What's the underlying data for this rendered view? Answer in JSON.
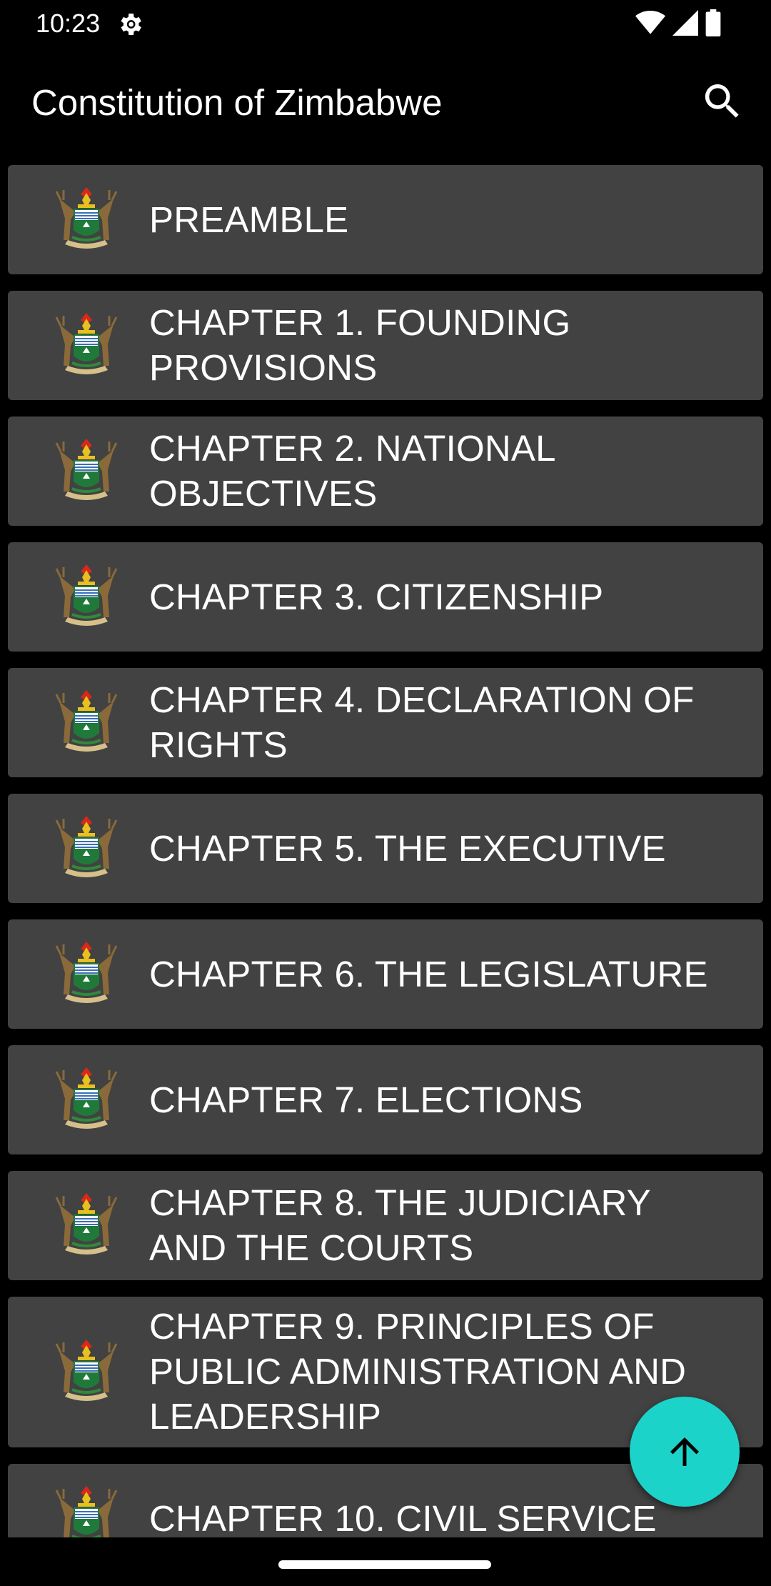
{
  "status_bar": {
    "time": "10:23",
    "icons": [
      "settings-gear-icon",
      "wifi-icon",
      "signal-icon",
      "battery-icon"
    ]
  },
  "app_bar": {
    "title": "Constitution of Zimbabwe",
    "search_icon": "search-icon"
  },
  "colors": {
    "background": "#000000",
    "card": "#424242",
    "fab": "#1bd3c9",
    "text": "#ffffff"
  },
  "chapters": [
    {
      "label": "PREAMBLE",
      "icon": "coat-of-arms-icon"
    },
    {
      "label": "CHAPTER 1. FOUNDING PROVISIONS",
      "icon": "coat-of-arms-icon"
    },
    {
      "label": "CHAPTER 2. NATIONAL OBJECTIVES",
      "icon": "coat-of-arms-icon"
    },
    {
      "label": "CHAPTER 3. CITIZENSHIP",
      "icon": "coat-of-arms-icon"
    },
    {
      "label": "CHAPTER 4. DECLARATION OF RIGHTS",
      "icon": "coat-of-arms-icon"
    },
    {
      "label": "CHAPTER 5. THE EXECUTIVE",
      "icon": "coat-of-arms-icon"
    },
    {
      "label": "CHAPTER 6. THE LEGISLATURE",
      "icon": "coat-of-arms-icon"
    },
    {
      "label": "CHAPTER 7. ELECTIONS",
      "icon": "coat-of-arms-icon"
    },
    {
      "label": "CHAPTER 8. THE JUDICIARY AND THE COURTS",
      "icon": "coat-of-arms-icon"
    },
    {
      "label": "CHAPTER 9. PRINCIPLES OF PUBLIC ADMINISTRATION AND LEADERSHIP",
      "icon": "coat-of-arms-icon"
    },
    {
      "label": "CHAPTER 10. CIVIL SERVICE",
      "icon": "coat-of-arms-icon"
    }
  ],
  "fab": {
    "icon": "arrow-up-icon"
  }
}
